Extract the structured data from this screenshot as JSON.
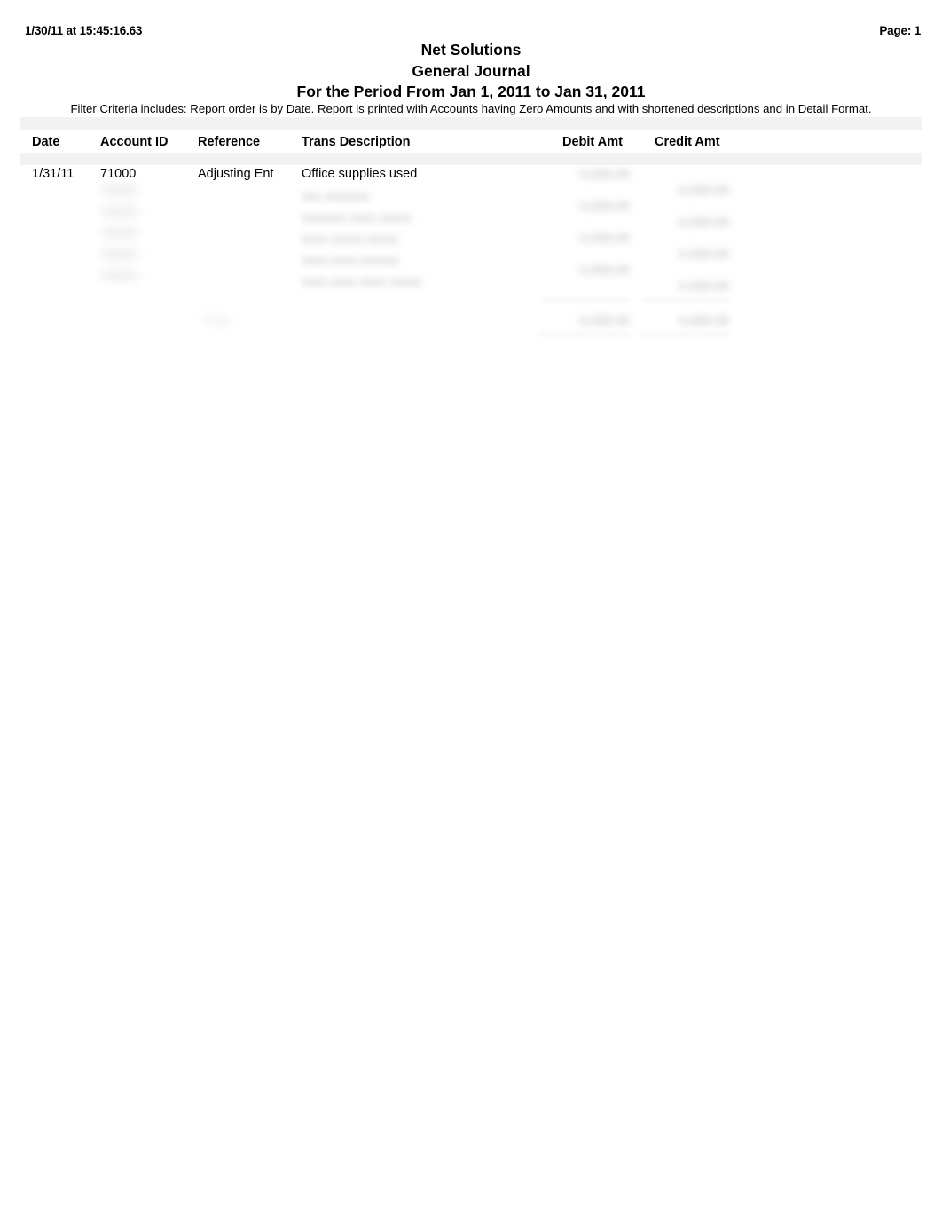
{
  "header": {
    "timestamp": "1/30/11 at 15:45:16.63",
    "page_label": "Page: 1"
  },
  "title": {
    "company": "Net Solutions",
    "report": "General Journal",
    "period": "For the Period From Jan 1, 2011 to Jan 31, 2011"
  },
  "filter": {
    "criteria": "Filter Criteria includes: Report order is by Date. Report is printed with Accounts having Zero Amounts and with shortened descriptions and in Detail Format."
  },
  "table": {
    "columns": [
      {
        "key": "date",
        "label": "Date"
      },
      {
        "key": "account_id",
        "label": "Account ID"
      },
      {
        "key": "reference",
        "label": "Reference"
      },
      {
        "key": "description",
        "label": "Trans Description"
      },
      {
        "key": "debit",
        "label": "Debit Amt"
      },
      {
        "key": "credit",
        "label": "Credit Amt"
      }
    ],
    "rows": [
      {
        "date": "1/31/11",
        "account_id": "71000",
        "reference": "Adjusting Ent",
        "description": "Office supplies used",
        "debit": "",
        "credit": "",
        "redacted": false
      }
    ],
    "redacted_rows": [
      {
        "account_id": "00000",
        "description": "xxx xxxxxxx",
        "debit": "0,000.00",
        "credit": ""
      },
      {
        "account_id": "00000",
        "description": "xxxxxxx xxxx xxxxx",
        "debit": "0,000.00",
        "credit": "0,000.00"
      },
      {
        "account_id": "00000",
        "description": "xxxx xxxxx xxxxx",
        "debit": "0,000.00",
        "credit": "0,000.00"
      },
      {
        "account_id": "00000",
        "description": "xxxx xxxx xxxxxx",
        "debit": "0,000.00",
        "credit": "0,000.00"
      },
      {
        "account_id": "00000",
        "description": "xxxx xxxx xxxx xxxxx",
        "debit": "",
        "credit": "0,000.00"
      }
    ],
    "total": {
      "label": "Total",
      "debit": "0,000.00",
      "credit": "0,000.00"
    }
  },
  "colors": {
    "page_background": "#ffffff",
    "text": "#000000",
    "band": "#f2f2f2",
    "redacted_text": "#9a9a9a",
    "rule": "#c8c8c8"
  }
}
